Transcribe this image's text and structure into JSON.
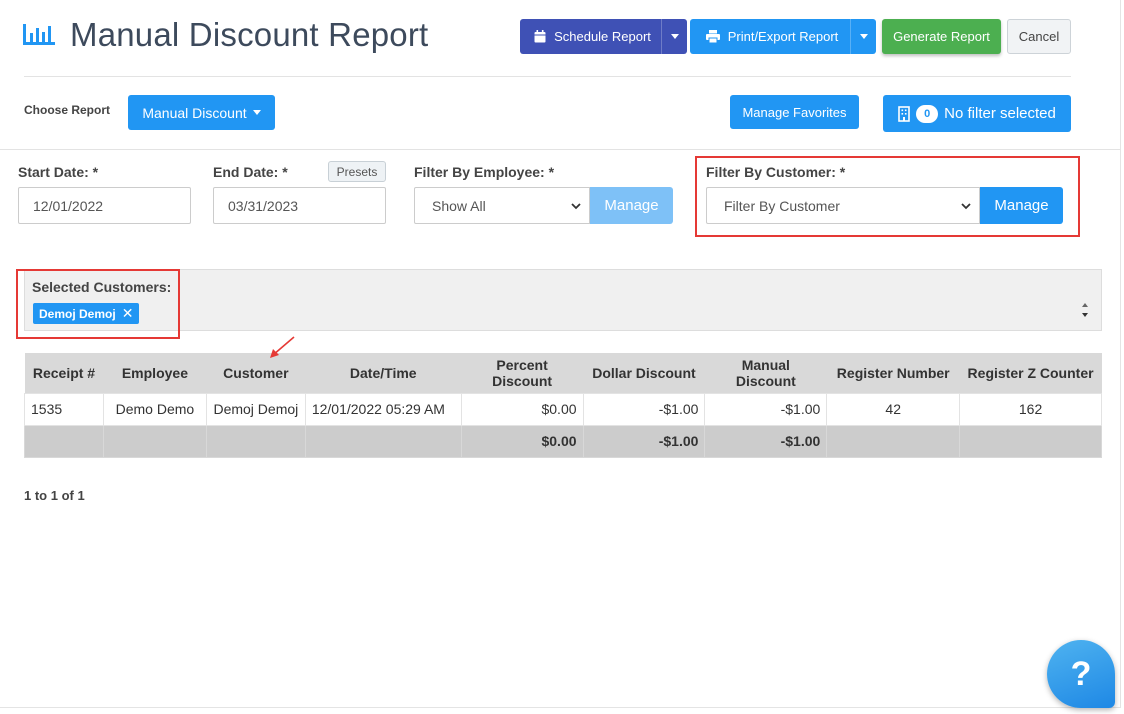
{
  "header": {
    "title": "Manual Discount Report",
    "schedule_label": "Schedule Report",
    "print_label": "Print/Export Report",
    "generate_label": "Generate Report",
    "cancel_label": "Cancel"
  },
  "toolbar": {
    "choose_label": "Choose Report",
    "report_selected": "Manual Discount",
    "manage_favorites_label": "Manage Favorites",
    "filter_count": "0",
    "filter_status": "No filter selected"
  },
  "filters": {
    "start_date_label": "Start Date: *",
    "start_date_value": "12/01/2022",
    "end_date_label": "End Date: *",
    "end_date_value": "03/31/2023",
    "presets_label": "Presets",
    "employee_label": "Filter By Employee: *",
    "employee_value": "Show All",
    "customer_label": "Filter By Customer: *",
    "customer_value": "Filter By Customer",
    "manage_label": "Manage"
  },
  "selected_customers": {
    "label": "Selected Customers:",
    "items": [
      "Demoj Demoj"
    ]
  },
  "table": {
    "headers": [
      "Receipt #",
      "Employee",
      "Customer",
      "Date/Time",
      "Percent Discount",
      "Dollar Discount",
      "Manual Discount",
      "Register Number",
      "Register Z Counter"
    ],
    "rows": [
      [
        "1535",
        "Demo Demo",
        "Demoj Demoj",
        "12/01/2022 05:29 AM",
        "$0.00",
        "-$1.00",
        "-$1.00",
        "42",
        "162"
      ]
    ],
    "totals": [
      "",
      "",
      "",
      "",
      "$0.00",
      "-$1.00",
      "-$1.00",
      "",
      ""
    ]
  },
  "pagination": "1 to 1 of 1",
  "help_label": "?",
  "colors": {
    "primary": "#2196f3",
    "schedule": "#3f51b5",
    "generate": "#4caf50",
    "highlight": "#e53935"
  }
}
